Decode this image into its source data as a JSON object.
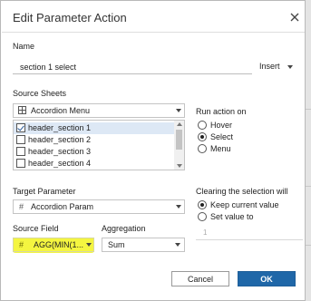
{
  "dialog": {
    "title": "Edit Parameter Action",
    "close_icon": "close-icon"
  },
  "name": {
    "label": "Name",
    "value": "section 1 select",
    "insert_label": "Insert"
  },
  "source_sheets": {
    "label": "Source Sheets",
    "selected": "Accordion Menu",
    "items": [
      {
        "label": "header_section 1",
        "checked": true
      },
      {
        "label": "header_section 2",
        "checked": false
      },
      {
        "label": "header_section 3",
        "checked": false
      },
      {
        "label": "header_section 4",
        "checked": false
      }
    ]
  },
  "run_action_on": {
    "label": "Run action on",
    "options": [
      "Hover",
      "Select",
      "Menu"
    ],
    "selected": "Select"
  },
  "target_parameter": {
    "label": "Target Parameter",
    "value": "Accordion Param"
  },
  "clearing": {
    "label": "Clearing the selection will",
    "options": [
      "Keep current value",
      "Set value to"
    ],
    "selected": "Keep current value",
    "set_value": "1"
  },
  "source_field": {
    "label": "Source Field",
    "value": "AGG(MIN(1...",
    "highlight_color": "#f4f540"
  },
  "aggregation": {
    "label": "Aggregation",
    "value": "Sum"
  },
  "buttons": {
    "cancel": "Cancel",
    "ok": "OK"
  },
  "colors": {
    "ok_button": "#1f67a8",
    "list_selection": "#dde8f5"
  }
}
